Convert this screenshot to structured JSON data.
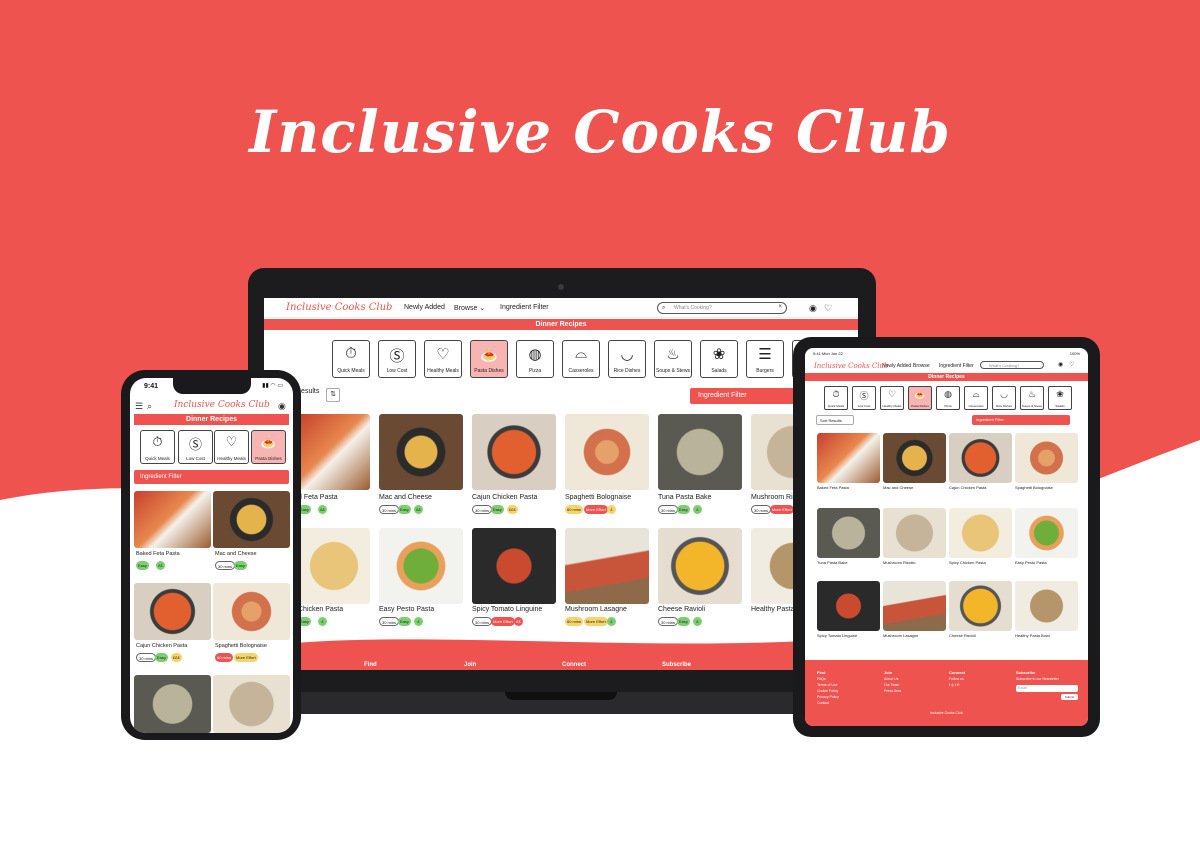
{
  "brand": {
    "headline": "Inclusive Cooks Club",
    "color": "#ef5350"
  },
  "laptop": {
    "logo": "Inclusive Cooks Club",
    "nav": [
      "Newly Added",
      "Browse",
      "Ingredient Filter"
    ],
    "search_placeholder": "What's Cooking?",
    "banner": "Dinner Recipes",
    "categories": [
      "Quick Meals",
      "Low Cost",
      "Healthy Meals",
      "Pasta Dishes",
      "Pizza",
      "Casseroles",
      "Rice Dishes",
      "Soups & Stews",
      "Salads",
      "Burgers"
    ],
    "results_label": "Results",
    "filter_label": "Ingredient Filter",
    "row1": [
      "d Feta Pasta",
      "Mac and Cheese",
      "Cajun Chicken Pasta",
      "Spaghetti Bolognaise",
      "Tuna Pasta Bake",
      "Mushroom Riso"
    ],
    "row2": [
      "Chicken Pasta",
      "Easy Pesto Pasta",
      "Spicy Tomato Linguine",
      "Mushroom Lasagne",
      "Cheese Ravioli",
      "Healthy Pasta B"
    ],
    "tags": {
      "time_30": "30 mins",
      "time_60": "60 mins",
      "easy": "Easy",
      "more_effort": "More Effort",
      "cost_1": "£",
      "cost_2": "££",
      "cost_3": "£££"
    },
    "footer": [
      "Find",
      "Join",
      "Connect",
      "Subscribe"
    ]
  },
  "phone": {
    "time": "9:41",
    "logo": "Inclusive Cooks Club",
    "banner": "Dinner Recipes",
    "categories": [
      "Quick Meals",
      "Low Cost",
      "Healthy Meals",
      "Pasta Dishes"
    ],
    "filter_label": "Ingredient Filter",
    "cards": [
      "Baked Feta Pasta",
      "Mac and Cheese",
      "Cajun Chicken Pasta",
      "Spaghetti Bolognaise"
    ]
  },
  "tablet": {
    "time": "9:41  Mon Jun 22",
    "battery": "100%",
    "logo": "Inclusive Cooks Club",
    "nav": [
      "Newly Added",
      "Browse",
      "Ingredient Filter"
    ],
    "search_placeholder": "What's Cooking?",
    "banner": "Dinner Recipes",
    "categories": [
      "Quick Meals",
      "Low Cost",
      "Healthy Meals",
      "Pasta Dishes",
      "Pizza",
      "Casseroles",
      "Rice Dishes",
      "Soups & Stews",
      "Salads"
    ],
    "sort_label": "Sort Results",
    "filter_label": "Ingredient Filter",
    "cards": [
      "Baked Feta Pasta",
      "Mac and Cheese",
      "Cajun Chicken Pasta",
      "Spaghetti Bolognaise",
      "Tuna Pasta Bake",
      "Mushroom Risotto",
      "Spicy Chicken Pasta",
      "Easy Pesto Pasta",
      "Spicy Tomato Linguine",
      "Mushroom Lasagne",
      "Cheese Ravioli",
      "Healthy Pasta Bowl"
    ],
    "footer": {
      "find": "Find",
      "find_links": [
        "FAQs",
        "Terms of Use",
        "Cookie Policy",
        "Privacy Policy",
        "Contact"
      ],
      "join": "Join",
      "join_links": [
        "About Us",
        "Our Team",
        "Press Area"
      ],
      "connect": "Connect",
      "connect_text": "Follow us",
      "subscribe": "Subscribe",
      "subscribe_text": "Subscribe to our Newsletter",
      "email_placeholder": "Email",
      "submit": "Submit",
      "copyright": "Inclusive Cooks Club"
    }
  }
}
